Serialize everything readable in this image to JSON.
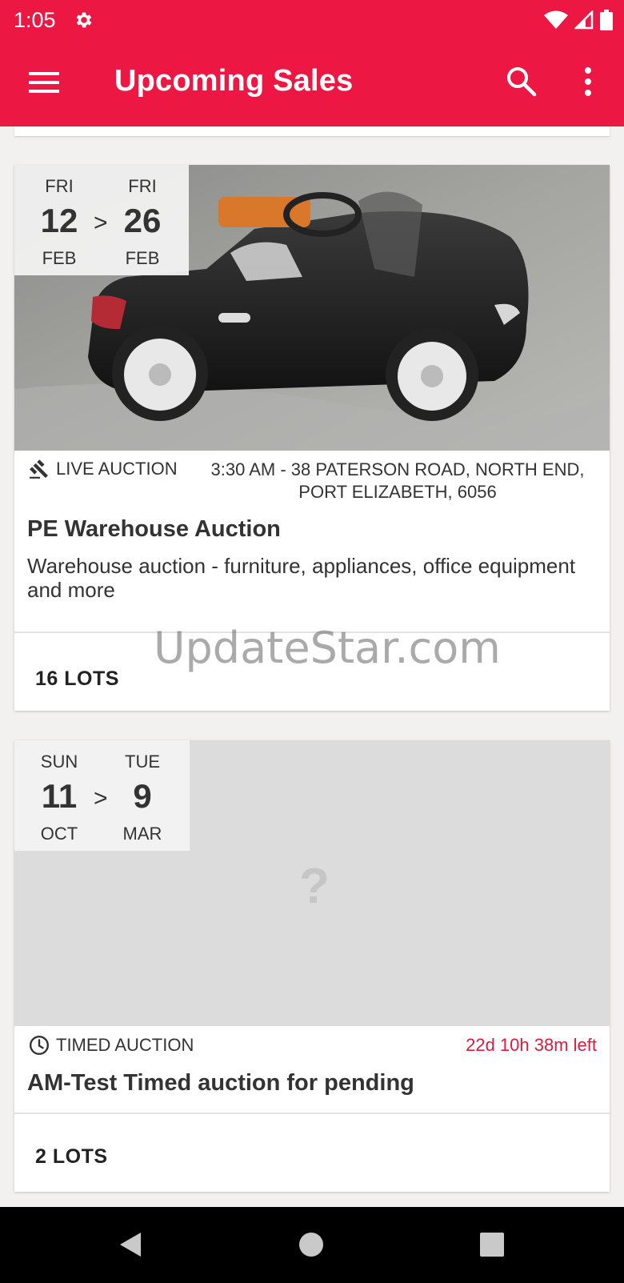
{
  "status_bar": {
    "time": "1:05"
  },
  "app_bar": {
    "title": "Upcoming Sales"
  },
  "sales": [
    {
      "start": {
        "dow": "FRI",
        "day": "12",
        "month": "FEB"
      },
      "end": {
        "dow": "FRI",
        "day": "26",
        "month": "FEB"
      },
      "separator": ">",
      "type": "LIVE AUCTION",
      "location_line1": "3:30 AM - 38 PATERSON ROAD, NORTH END,",
      "location_line2": "PORT ELIZABETH, 6056",
      "title": "PE Warehouse Auction",
      "description": "Warehouse auction - furniture, appliances, office equipment and more",
      "lots": "16 LOTS"
    },
    {
      "start": {
        "dow": "SUN",
        "day": "11",
        "month": "OCT"
      },
      "end": {
        "dow": "TUE",
        "day": "9",
        "month": "MAR"
      },
      "separator": ">",
      "type": "TIMED AUCTION",
      "time_left": "22d 10h 38m left",
      "placeholder": "?",
      "title": "AM-Test Timed auction for pending",
      "lots": "2 LOTS"
    }
  ],
  "watermark": "UpdateStar.com",
  "colors": {
    "brand": "#ec1743",
    "countdown": "#e01a3c",
    "placeholder": "#dcdcdc"
  },
  "icons": [
    "settings-icon",
    "wifi-icon",
    "cell-signal-icon",
    "battery-icon",
    "menu-icon",
    "search-icon",
    "more-vert-icon",
    "gavel-icon",
    "clock-icon",
    "back-icon",
    "home-icon",
    "recents-icon"
  ]
}
